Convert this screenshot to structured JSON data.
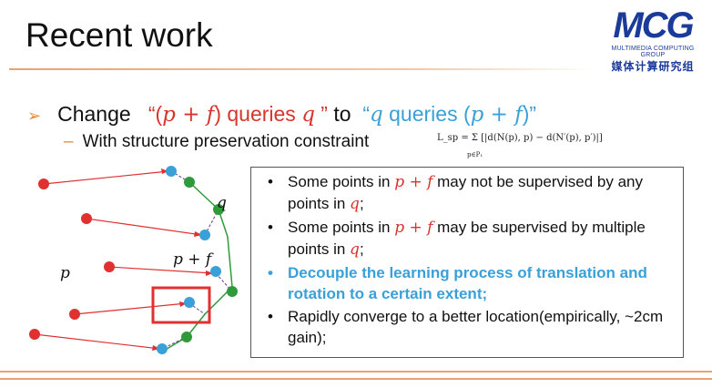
{
  "slide": {
    "title": "Recent work"
  },
  "logo": {
    "mark": "MCG",
    "line1": "MULTIMEDIA COMPUTING GROUP",
    "line2": "媒体计算研究组"
  },
  "heading": {
    "bullet": "➢",
    "change": "Change",
    "q_open": "“(",
    "p_plus_f": "p + f",
    "q_mid": ") queries",
    "q_var": "q",
    "q_close": " ”",
    "to": "to",
    "b_open": "“",
    "b_q": "q",
    "b_mid": " queries (",
    "b_pf": "p + f",
    "b_close": ")”"
  },
  "subpoint": {
    "dash": "–",
    "text": "With structure preservation constraint",
    "formula": "L_sp = Σ [|d(N(p), p) − d(N′(p), p′)|]",
    "formula_sub": "p∈P₁"
  },
  "diagram": {
    "label_q": "q",
    "label_pf": "p + f",
    "label_p": "p",
    "colors": {
      "red_points": "#e03030",
      "blue_points": "#3aa0d8",
      "green_points": "#2f9a3a",
      "box": "#e03030"
    }
  },
  "panel": {
    "items": [
      {
        "bullet": "•",
        "pre": "Some points in ",
        "math": "p + f",
        "post": " may not be supervised by any points in ",
        "math2": "q",
        "end": ";",
        "highlight": false
      },
      {
        "bullet": "•",
        "pre": " Some points in ",
        "math": "p + f",
        "post": " may be supervised by multiple points in ",
        "math2": "q",
        "end": ";",
        "highlight": false
      },
      {
        "bullet": "•",
        "pre": "Decouple the learning process of translation and rotation to a certain extent;",
        "math": "",
        "post": "",
        "math2": "",
        "end": "",
        "highlight": true
      },
      {
        "bullet": "•",
        "pre": "Rapidly converge to a better location(empirically, ~2cm gain);",
        "math": "",
        "post": "",
        "math2": "",
        "end": "",
        "highlight": false
      }
    ]
  }
}
